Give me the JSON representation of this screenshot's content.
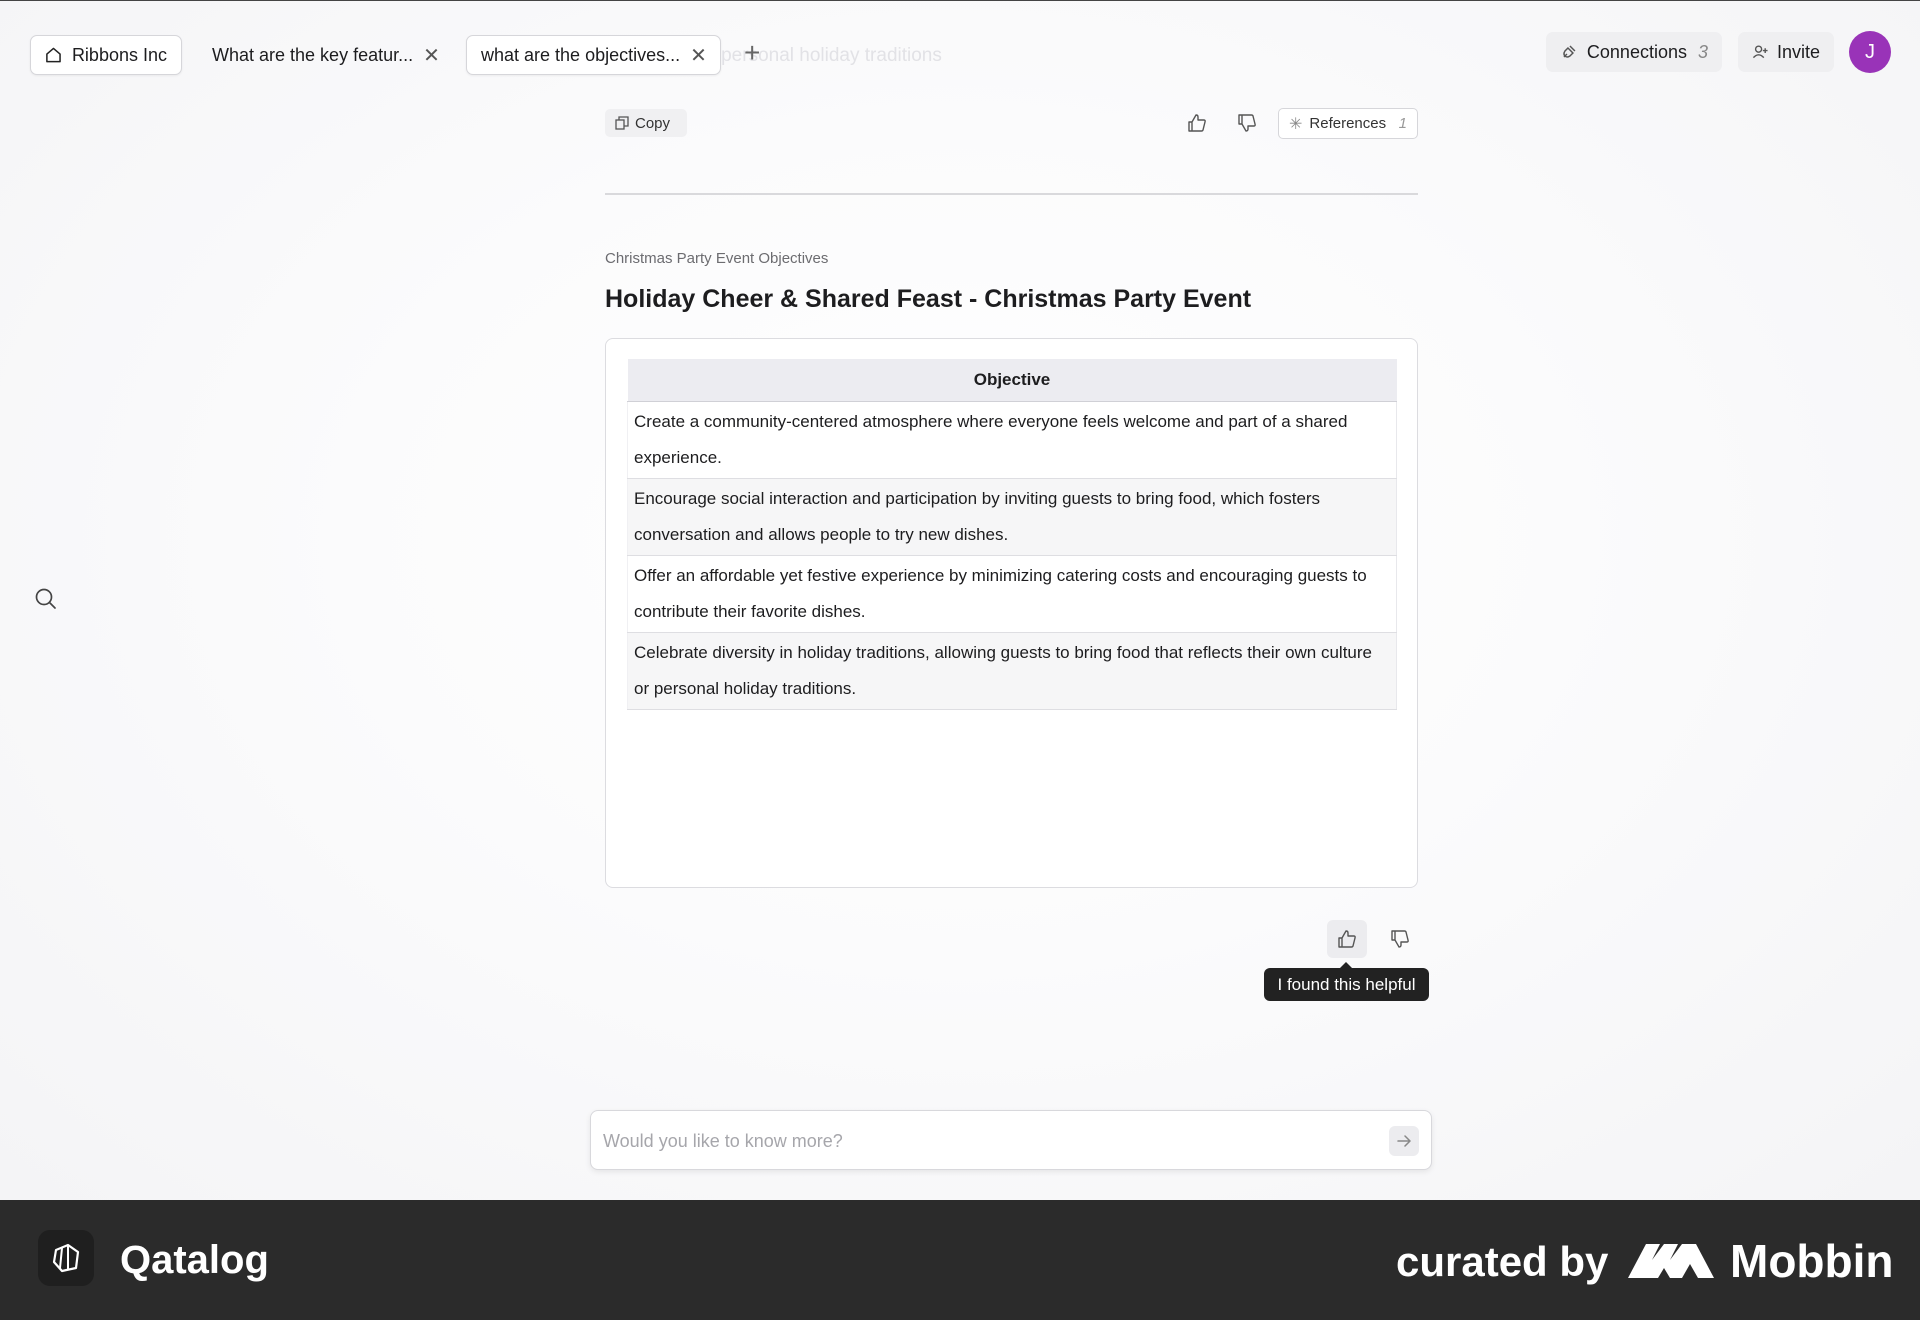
{
  "header": {
    "ghost_text": "... personal holiday traditions",
    "home_tab": "Ribbons Inc",
    "tabs": [
      {
        "label": "What are the key featur..."
      },
      {
        "label": "what are the objectives..."
      }
    ],
    "connections_label": "Connections",
    "connections_count": "3",
    "invite_label": "Invite",
    "avatar_initial": "J"
  },
  "actions": {
    "copy_label": "Copy",
    "references_label": "References",
    "references_count": "1"
  },
  "content": {
    "subheading": "Christmas Party Event Objectives",
    "title": "Holiday Cheer & Shared Feast - Christmas Party Event",
    "table": {
      "header": "Objective",
      "rows": [
        "Create a community-centered atmosphere where everyone feels welcome and part of a shared experience.",
        "Encourage social interaction and participation by inviting guests to bring food, which fosters conversation and allows people to try new dishes.",
        "Offer an affordable yet festive experience by minimizing catering costs and encouraging guests to contribute their favorite dishes.",
        "Celebrate diversity in holiday traditions, allowing guests to bring food that reflects their own culture or personal holiday traditions."
      ]
    }
  },
  "feedback": {
    "tooltip": "I found this helpful"
  },
  "ask": {
    "placeholder": "Would you like to know more?"
  },
  "footer": {
    "brand": "Qatalog",
    "curated": "curated by",
    "mobbin": "Mobbin"
  },
  "colors": {
    "avatar": "#9933b8",
    "footer_bg": "#2b2b2b"
  }
}
